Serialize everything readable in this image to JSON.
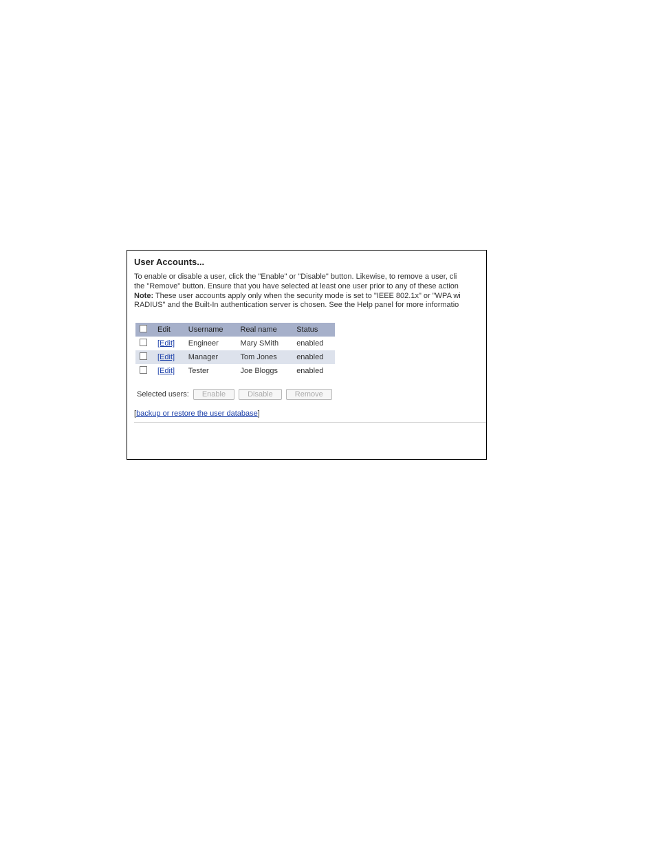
{
  "panel": {
    "title": "User Accounts...",
    "desc_line1": "To enable or disable a user, click the \"Enable\" or \"Disable\" button. Likewise, to remove a user, cli",
    "desc_line2": "the \"Remove\" button. Ensure that you have selected at least one user prior to any of these action",
    "note_label": "Note:",
    "desc_line3": " These user accounts apply only when the security mode is set to \"IEEE 802.1x\" or \"WPA wi",
    "desc_line4": "RADIUS\" and the Built-In authentication server is chosen. See the Help panel for more informatio"
  },
  "table": {
    "headers": {
      "edit": "Edit",
      "username": "Username",
      "realname": "Real name",
      "status": "Status"
    },
    "rows": [
      {
        "edit": "[Edit]",
        "username": "Engineer",
        "realname": "Mary SMith",
        "status": "enabled"
      },
      {
        "edit": "[Edit]",
        "username": "Manager",
        "realname": "Tom Jones",
        "status": "enabled"
      },
      {
        "edit": "[Edit]",
        "username": "Tester",
        "realname": "Joe Bloggs",
        "status": "enabled"
      }
    ]
  },
  "actions": {
    "selected_label": "Selected users:",
    "enable": "Enable",
    "disable": "Disable",
    "remove": "Remove"
  },
  "backup": {
    "link": "backup or restore the user database"
  }
}
